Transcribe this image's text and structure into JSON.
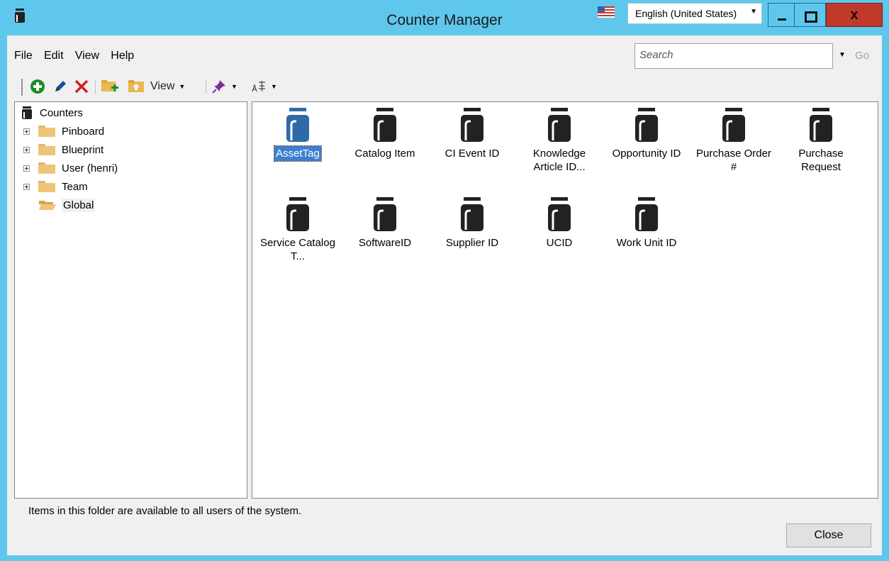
{
  "window": {
    "title": "Counter Manager",
    "language": "English (United States)",
    "close_symbol": "x"
  },
  "menu": {
    "items": [
      "File",
      "Edit",
      "View",
      "Help"
    ]
  },
  "search": {
    "placeholder": "Search",
    "go_label": "Go"
  },
  "toolbar": {
    "view_label": "View",
    "icons": [
      "add-icon",
      "edit-pencil-icon",
      "delete-icon",
      "new-folder-icon",
      "folder-up-icon",
      "pin-icon",
      "font-icon"
    ]
  },
  "tree": {
    "root": "Counters",
    "folders": [
      "Pinboard",
      "Blueprint",
      "User (henri)",
      "Team",
      "Global"
    ],
    "selected": "Global"
  },
  "items": [
    {
      "label": "AssetTag",
      "selected": true
    },
    {
      "label": "Catalog Item",
      "selected": false
    },
    {
      "label": "CI Event ID",
      "selected": false
    },
    {
      "label": "Knowledge Article ID...",
      "selected": false
    },
    {
      "label": "Opportunity ID",
      "selected": false
    },
    {
      "label": "Purchase Order #",
      "selected": false
    },
    {
      "label": "Purchase Request",
      "selected": false
    },
    {
      "label": "Service Catalog T...",
      "selected": false
    },
    {
      "label": "SoftwareID",
      "selected": false
    },
    {
      "label": "Supplier ID",
      "selected": false
    },
    {
      "label": "UCID",
      "selected": false
    },
    {
      "label": "Work Unit ID",
      "selected": false
    }
  ],
  "status": {
    "text": "Items in this folder are available to all users of the system."
  },
  "buttons": {
    "close": "Close"
  },
  "colors": {
    "title_bar": "#5fc7ec",
    "selection": "#3d7fcf",
    "close_button": "#c1392b",
    "counter_icon": "#222222",
    "counter_icon_selected": "#2f6aa8"
  }
}
